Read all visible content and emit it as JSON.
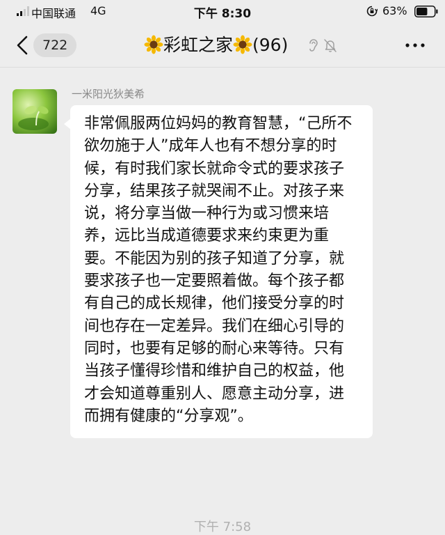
{
  "status_bar": {
    "carrier": "中国联通",
    "network": "4G",
    "time": "下午 8:30",
    "battery_percent": "63%",
    "battery_level": 0.63
  },
  "nav": {
    "unread_count": "722",
    "title_text": "彩虹之家",
    "member_count": "(96)",
    "title_decoration_icon": "sunflower-icon",
    "status_icons": [
      "ear-icon",
      "bell-mute-icon"
    ]
  },
  "message": {
    "sender": "一米阳光狄美希",
    "text": "非常佩服两位妈妈的教育智慧，“己所不欲勿施于人”成年人也有不想分享的时候，有时我们家长就命令式的要求孩子分享，结果孩子就哭闹不止。对孩子来说，将分享当做一种行为或习惯来培养，远比当成道德要求来约束更为重要。不能因为别的孩子知道了分享，就要求孩子也一定要照着做。每个孩子都有自己的成长规律，他们接受分享的时间也存在一定差异。我们在细心引导的同时，也要有足够的耐心来等待。只有当孩子懂得珍惜和维护自己的权益，他才会知道尊重别人、愿意主动分享，进而拥有健康的“分享观”。"
  },
  "timestamp": "下午 7:58",
  "colors": {
    "background": "#ededed",
    "bubble": "#ffffff",
    "badge": "#dcdcdc",
    "muted_text": "#888888"
  }
}
